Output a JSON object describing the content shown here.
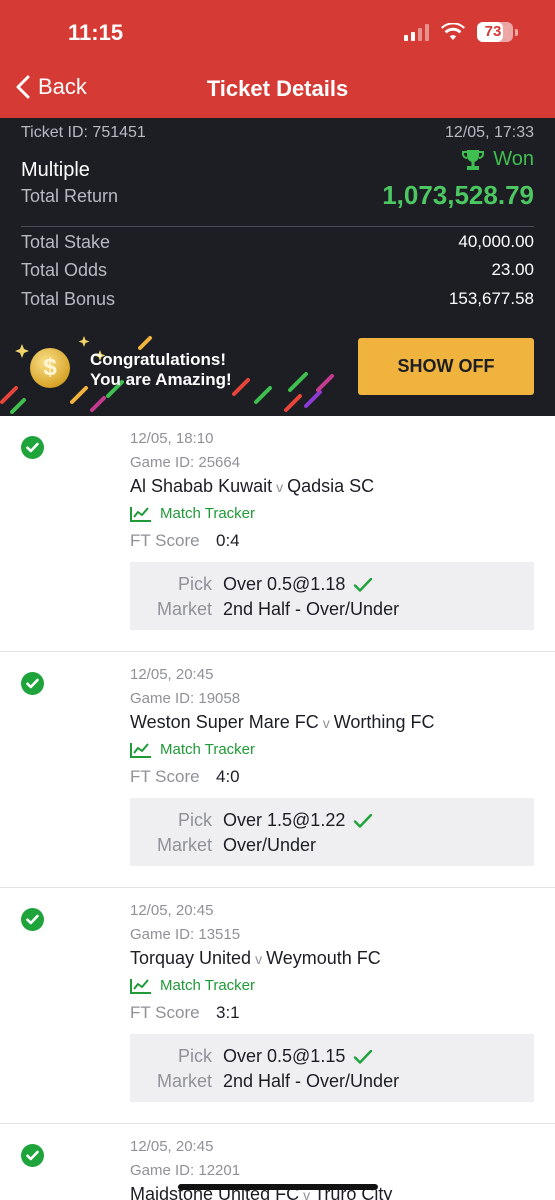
{
  "status_bar": {
    "time": "11:15",
    "battery": "73",
    "battery_level": 0.73
  },
  "nav": {
    "back_label": "Back",
    "title": "Ticket Details"
  },
  "ticket": {
    "id_label": "Ticket ID: 751451",
    "datetime": "12/05, 17:33",
    "status": "Won",
    "bet_type": "Multiple",
    "total_return_label": "Total Return",
    "total_return": "1,073,528.79",
    "rows": [
      {
        "label": "Total Stake",
        "value": "40,000.00"
      },
      {
        "label": "Total Odds",
        "value": "23.00"
      },
      {
        "label": "Total Bonus",
        "value": "153,677.58"
      }
    ]
  },
  "promo": {
    "line1": "Congratulations!",
    "line2": "You are Amazing!",
    "button": "SHOW OFF"
  },
  "labels": {
    "ft_score": "FT Score",
    "pick": "Pick",
    "market": "Market",
    "match_tracker": "Match Tracker",
    "vs": "v"
  },
  "games": [
    {
      "datetime": "12/05, 18:10",
      "game_id": "Game ID: 25664",
      "home": "Al Shabab Kuwait",
      "away": "Qadsia SC",
      "score": "0:4",
      "pick": "Over 0.5@1.18",
      "market": "2nd Half - Over/Under"
    },
    {
      "datetime": "12/05, 20:45",
      "game_id": "Game ID: 19058",
      "home": "Weston Super Mare FC",
      "away": "Worthing FC",
      "score": "4:0",
      "pick": "Over 1.5@1.22",
      "market": "Over/Under"
    },
    {
      "datetime": "12/05, 20:45",
      "game_id": "Game ID: 13515",
      "home": "Torquay United",
      "away": "Weymouth FC",
      "score": "3:1",
      "pick": "Over 0.5@1.15",
      "market": "2nd Half - Over/Under"
    },
    {
      "datetime": "12/05, 20:45",
      "game_id": "Game ID: 12201",
      "home": "Maidstone United FC",
      "away": "Truro City"
    }
  ],
  "colors": {
    "header_red": "#d63a35",
    "dark_bg": "#1c1e23",
    "win_green": "#4cc761",
    "button_gold": "#f0b33e"
  }
}
